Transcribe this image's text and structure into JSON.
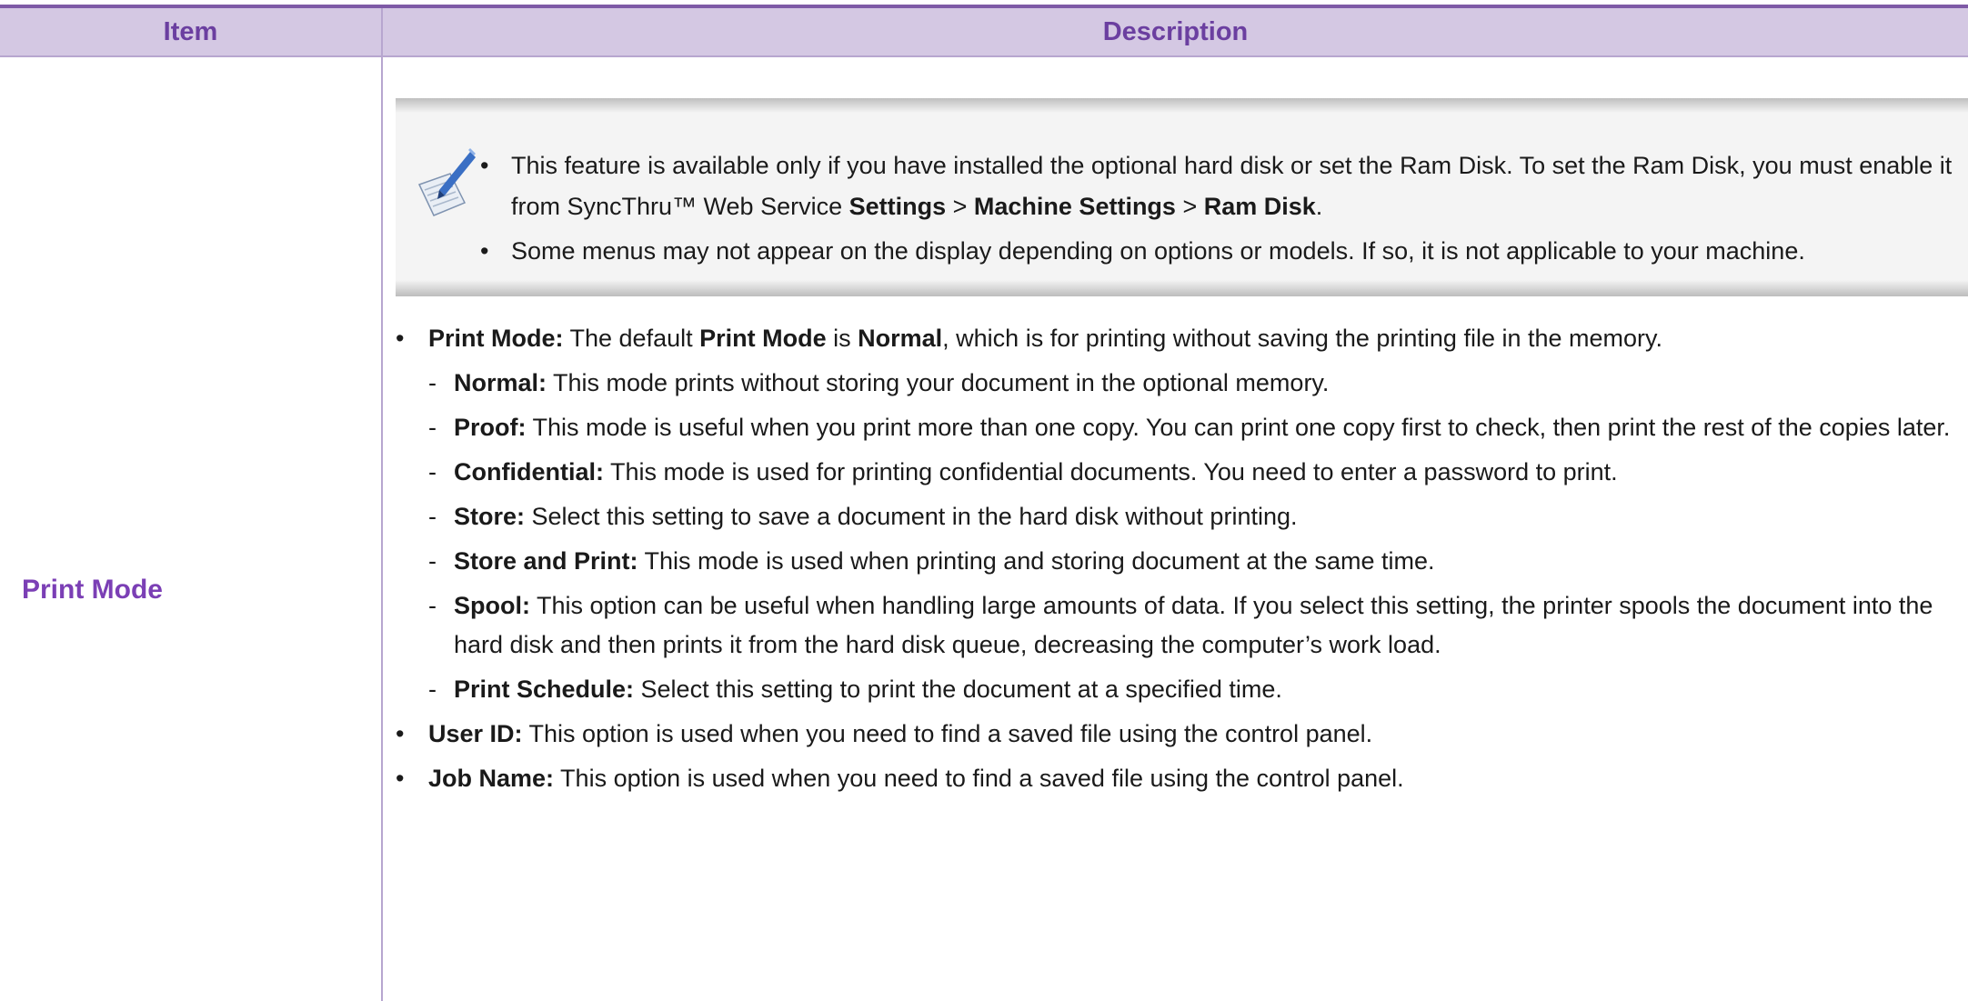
{
  "table": {
    "header": {
      "item": "Item",
      "description": "Description"
    },
    "row": {
      "item_label": "Print Mode"
    }
  },
  "note": {
    "icon": "note-pen-icon",
    "bullets": [
      {
        "bullet": "•",
        "text_before": " This feature is available only if you have installed the optional hard disk or set the Ram Disk. To set the Ram Disk, you must enable it from SyncThru™ Web Service ",
        "bold_settings": "Settings",
        "sep1": " > ",
        "bold_machine": "Machine Settings",
        "sep2": " > ",
        "bold_ramdisk": "Ram Disk",
        "end": "."
      },
      {
        "bullet": "•",
        "text": "Some menus may not appear on the display depending on options or models. If so, it is not applicable to your machine."
      }
    ]
  },
  "description": {
    "print_mode": {
      "bullet": "•",
      "label": "Print Mode:",
      "t1": " The default ",
      "b1": "Print Mode",
      "t2": " is ",
      "b2": "Normal",
      "t3": ", which is for printing without saving the printing file in the memory."
    },
    "modes": [
      {
        "dash": "-",
        "label": "Normal:",
        "text": " This mode prints without storing your document in the optional memory."
      },
      {
        "dash": "-",
        "label": "Proof:",
        "text": " This mode is useful when you print more than one copy. You can print one copy first to check, then print the rest of the copies later."
      },
      {
        "dash": "-",
        "label": "Confidential:",
        "text": " This mode is used for printing confidential documents. You need to enter a password to print."
      },
      {
        "dash": "-",
        "label": "Store:",
        "text": " Select this setting to save a document in the hard disk without printing."
      },
      {
        "dash": "-",
        "label": "Store and Print:",
        "text": " This mode is used when printing and storing document at the same time."
      },
      {
        "dash": "-",
        "label": "Spool:",
        "text": " This option can be useful when handling large amounts of data. If you select this setting, the printer spools the document into the hard disk and then prints it from the hard disk queue, decreasing the computer’s work load."
      },
      {
        "dash": "-",
        "label": "Print Schedule:",
        "text": " Select this setting to print the document at a specified time."
      }
    ],
    "user_id": {
      "bullet": "•",
      "label": "User ID:",
      "text": " This option is used when you need to find a saved file using the control panel."
    },
    "job_name": {
      "bullet": "•",
      "label": "Job Name:",
      "text": " This option is used when you need to find a saved file using the control panel."
    }
  },
  "colors": {
    "header_bg": "#d4c8e3",
    "accent_purple": "#7b3fb5",
    "rule": "#7e5aa6"
  }
}
